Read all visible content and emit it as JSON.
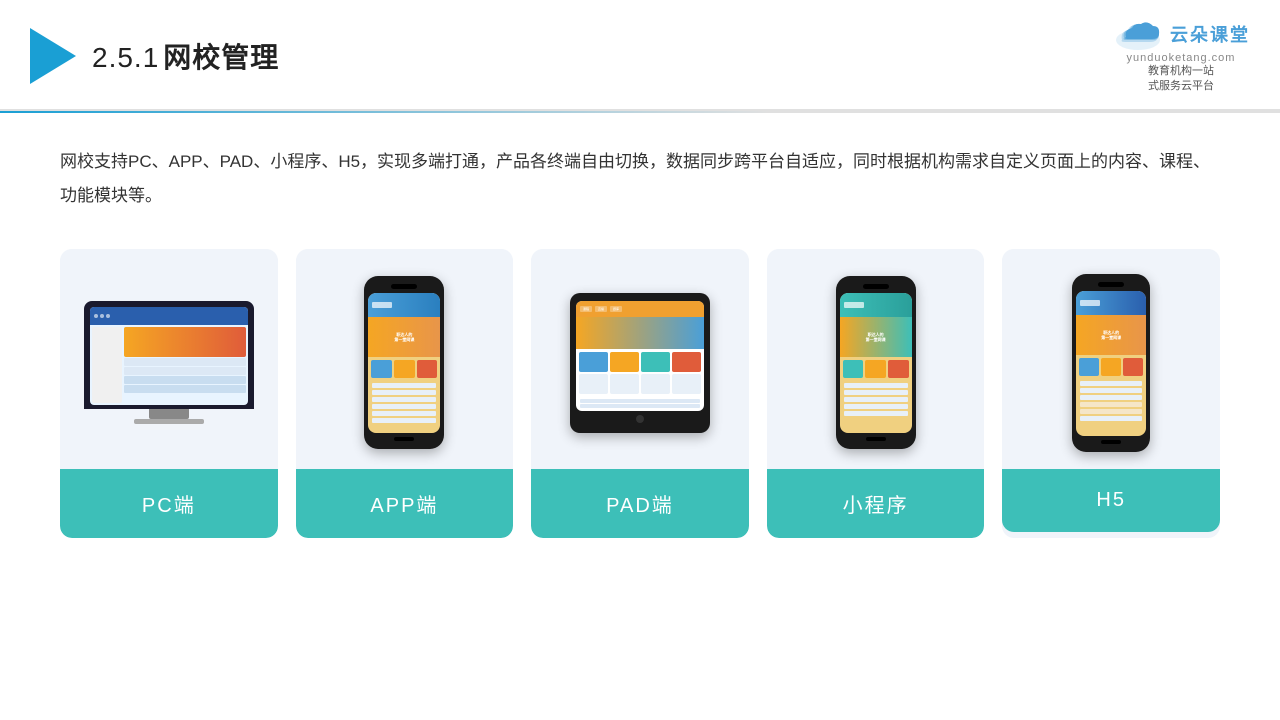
{
  "header": {
    "section_number": "2.5.1",
    "title": "网校管理",
    "logo_main": "云朵课堂",
    "logo_url_text": "yunduoketang.com",
    "logo_tagline_line1": "教育机构一站",
    "logo_tagline_line2": "式服务云平台"
  },
  "description": "网校支持PC、APP、PAD、小程序、H5，实现多端打通，产品各终端自由切换，数据同步跨平台自适应，同时根据机构需求自定义页面上的内容、课程、功能模块等。",
  "cards": [
    {
      "id": "pc",
      "label": "PC端"
    },
    {
      "id": "app",
      "label": "APP端"
    },
    {
      "id": "pad",
      "label": "PAD端"
    },
    {
      "id": "mini",
      "label": "小程序"
    },
    {
      "id": "h5",
      "label": "H5"
    }
  ],
  "colors": {
    "accent": "#1a9fd4",
    "card_label_bg": "#3dbfb8",
    "header_title": "#222",
    "description": "#333"
  }
}
